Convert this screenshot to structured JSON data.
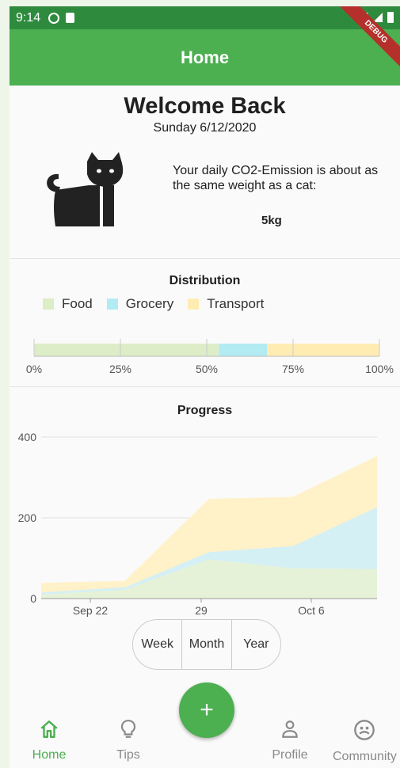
{
  "status": {
    "time": "9:14"
  },
  "debug_label": "DEBUG",
  "appbar": {
    "title": "Home"
  },
  "welcome": {
    "title": "Welcome Back",
    "date": "Sunday 6/12/2020"
  },
  "emission": {
    "text": "Your daily CO2-Emission is about as the same weight as a cat:",
    "value": "5kg",
    "icon": "cat-icon"
  },
  "distribution": {
    "title": "Distribution",
    "legend": [
      {
        "label": "Food",
        "color": "#dcedc8"
      },
      {
        "label": "Grocery",
        "color": "#b2ebf2"
      },
      {
        "label": "Transport",
        "color": "#ffecb3"
      }
    ],
    "ticks": [
      "0%",
      "25%",
      "50%",
      "75%",
      "100%"
    ]
  },
  "chart_data": [
    {
      "type": "bar",
      "title": "Distribution",
      "orientation": "horizontal-stacked",
      "series": [
        {
          "name": "Food",
          "values": [
            53.5
          ]
        },
        {
          "name": "Grocery",
          "values": [
            14
          ]
        },
        {
          "name": "Transport",
          "values": [
            32.5
          ]
        }
      ],
      "xlim": [
        0,
        100
      ],
      "tick_labels": [
        "0%",
        "25%",
        "50%",
        "75%",
        "100%"
      ]
    },
    {
      "type": "area",
      "title": "Progress",
      "stacked": true,
      "x": [
        0,
        1,
        2,
        3,
        4
      ],
      "x_tick_labels": [
        "Sep 22",
        "29",
        "Oct 6"
      ],
      "series": [
        {
          "name": "Food",
          "values": [
            10,
            22,
            97,
            75,
            73
          ],
          "color": "#e6f2d8"
        },
        {
          "name": "Grocery",
          "values": [
            5,
            6,
            18,
            55,
            153
          ],
          "color": "#d4f0f5"
        },
        {
          "name": "Transport",
          "values": [
            22,
            14,
            130,
            120,
            125
          ],
          "color": "#fff1c8"
        }
      ],
      "ylim": [
        0,
        400
      ],
      "y_ticks": [
        0,
        200,
        400
      ],
      "grid": true
    }
  ],
  "progress": {
    "title": "Progress"
  },
  "period_toggle": [
    "Week",
    "Month",
    "Year"
  ],
  "fab": {
    "label": "+"
  },
  "nav": [
    {
      "label": "Home",
      "icon": "home-icon",
      "active": true
    },
    {
      "label": "Tips",
      "icon": "lightbulb-icon"
    },
    {
      "label": "Profile",
      "icon": "person-icon"
    },
    {
      "label": "Community",
      "icon": "community-icon"
    }
  ]
}
